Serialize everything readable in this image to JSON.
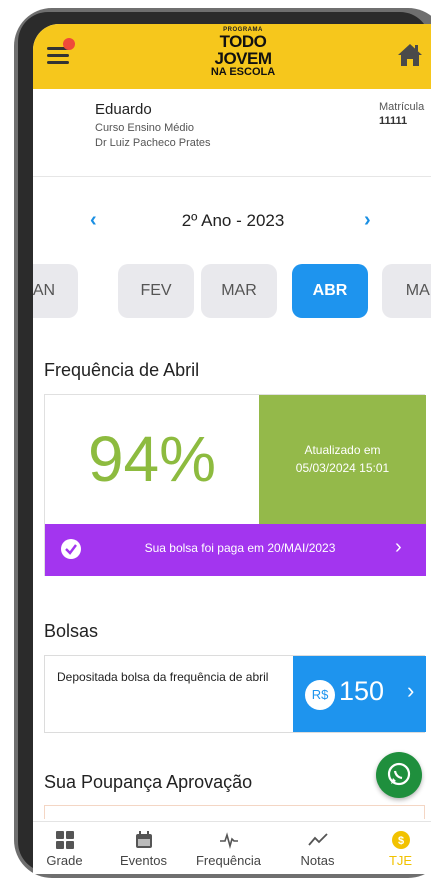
{
  "header": {
    "logo": {
      "line1": "PROGRAMA",
      "line2": "TODO",
      "line3": "JOVEM",
      "line4": "NA ESCOLA"
    },
    "menu_icon": "hamburger-icon",
    "home_icon": "home-icon",
    "colors": {
      "header_bg": "#f6c71c",
      "notification_dot": "#ef4a3a"
    }
  },
  "student": {
    "name": "Eduardo",
    "course": "Curso Ensino Médio",
    "school": "Dr Luiz Pacheco Prates",
    "matricula_label": "Matrícula",
    "matricula_value": "11111"
  },
  "year_nav": {
    "label": "2º Ano - 2023",
    "prev": "‹",
    "next": "›"
  },
  "months": [
    {
      "label": "JAN",
      "active": false
    },
    {
      "label": "FEV",
      "active": false
    },
    {
      "label": "MAR",
      "active": false
    },
    {
      "label": "ABR",
      "active": true
    },
    {
      "label": "MAI",
      "active": false
    }
  ],
  "frequency": {
    "title": "Frequência de Abril",
    "percent": "94%",
    "updated_line1": "Atualizado em",
    "updated_line2": "05/03/2024 15:01",
    "paid_text": "Sua bolsa foi paga em 20/MAI/2023",
    "paid_chevron": "›",
    "colors": {
      "percent": "#8dbb3f",
      "updated_bg": "#94b94a",
      "paid_bg": "#a335ef"
    }
  },
  "bolsas": {
    "title": "Bolsas",
    "description": "Depositada bolsa da frequência de abril",
    "currency": "R$",
    "amount": "150",
    "chevron": "›",
    "colors": {
      "value_bg": "#1e94ee"
    }
  },
  "poupanca": {
    "title": "Sua Poupança Aprovação"
  },
  "whatsapp_icon": "whatsapp-icon",
  "tabbar": [
    {
      "label": "Grade",
      "icon": "grid-icon",
      "active": false
    },
    {
      "label": "Eventos",
      "icon": "calendar-icon",
      "active": false
    },
    {
      "label": "Frequência",
      "icon": "pulse-icon",
      "active": false
    },
    {
      "label": "Notas",
      "icon": "trend-icon",
      "active": false
    },
    {
      "label": "TJE",
      "icon": "coin-icon",
      "active": true
    }
  ]
}
